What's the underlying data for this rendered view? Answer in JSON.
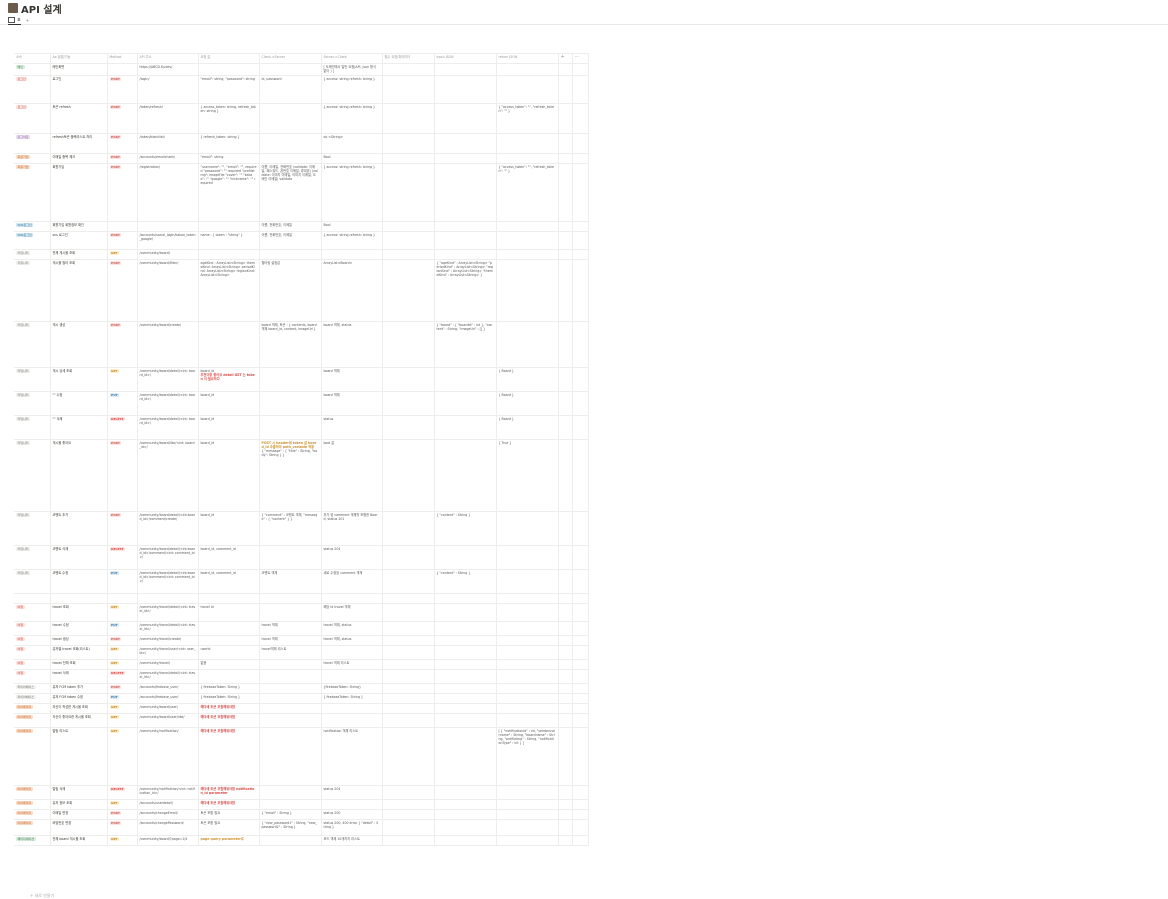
{
  "page": {
    "title": "API 설계",
    "icon_name": "page-icon"
  },
  "view": {
    "tab_label": "표",
    "add_label": "+"
  },
  "columns": [
    "소속",
    "Aa 설명/기능",
    "Method",
    "API 주소",
    "요청 값",
    "Client->Server",
    "Server->Client",
    "필수 요청/파라미터",
    "input JSON",
    "return JSON"
  ],
  "header_actions": {
    "add": "+",
    "more": "⋯"
  },
  "colors": {
    "GET": {
      "bg": "#fbeecf",
      "fg": "#b8862b"
    },
    "POST": {
      "bg": "#fde2e1",
      "fg": "#c4554d"
    },
    "PUT": {
      "bg": "#ddebf1",
      "fg": "#3b73a8"
    },
    "DELETE": {
      "bg": "#fde2e1",
      "fg": "#d44c47"
    }
  },
  "rows": [
    {
      "tag": "메인",
      "tag_bg": "#dbeddb",
      "tag_fg": "#448361",
      "name": "메인화면",
      "method": "",
      "url": "https://ABCD.fly.dev/",
      "req": "",
      "c2s": "",
      "s2c": "[ 도메인에서 일반 요청(API, json 형식 없이 ) ]",
      "input": "",
      "ret": "",
      "h": 12
    },
    {
      "tag": "로그인",
      "tag_bg": "#fde2e1",
      "tag_fg": "#c4554d",
      "name": "로그인",
      "method": "POST",
      "url": "/login/",
      "req": "\"email\": string, \"password\": string",
      "c2s": "id, password",
      "s2c": "{ access: string refresh: string }",
      "input": "",
      "ret": "",
      "h": 28
    },
    {
      "tag": "로그인",
      "tag_bg": "#fde2e1",
      "tag_fg": "#c4554d",
      "name": "토큰 refresh",
      "method": "POST",
      "url": "/token/refresh/",
      "req": "{ access_token: string, refresh_token: string }",
      "c2s": "",
      "s2c": "{ access: string refresh: string }",
      "input": "",
      "ret": "{ \"access_token\": \"\", \"refresh_token\": \"\" }",
      "h": 30
    },
    {
      "tag": "로그아웃",
      "tag_bg": "#e8deee",
      "tag_fg": "#9065b0",
      "name": "refresh토큰 블랙리스트 처리",
      "method": "POST",
      "url": "/token/blacklist/",
      "req": "{ refresh_token: string }",
      "c2s": "",
      "s2c": "ok <String>",
      "input": "",
      "ret": "",
      "h": 20
    },
    {
      "tag": "회원가입",
      "tag_bg": "#fadec9",
      "tag_fg": "#c2692c",
      "name": "이메일 중복 체크",
      "method": "POST",
      "url": "/accounts/emailcheck/",
      "req": "\"email\": string",
      "c2s": "",
      "s2c": "Bool",
      "input": "",
      "ret": "",
      "h": 10
    },
    {
      "tag": "회원가입",
      "tag_bg": "#fadec9",
      "tag_fg": "#c2692c",
      "name": "회원가입",
      "method": "POST",
      "url": "/registration/",
      "req": "\"username\": \"\", \"email\": \"\", required \"password\": \"\" required \"profileImg\": imageFile \"cover\": \"\" \"kakao\": \"\" \"google\": \"\" \"nickname\": \"\" required",
      "c2s": "이름, 이메일, 전화번호 (validate: 이메일, 패스워드, 폰번호 이메일, 휴대폰) (validate: 이미지 이메일, 이미지 이메일, 도메인 이메일) validate",
      "s2c": "{ access: string refresh: string }",
      "input": "",
      "ret": "{ \"access_token\": \"\", \"refresh_token\": \"\" }",
      "h": 58
    },
    {
      "tag": "SNS로그인",
      "tag_bg": "#d3e5ef",
      "tag_fg": "#337ea9",
      "name": "회원가입 회원정보 확인",
      "method": "",
      "url": "",
      "req": "",
      "c2s": "이름, 전화번호, 이메일",
      "s2c": "Bool",
      "input": "",
      "ret": "",
      "h": 10
    },
    {
      "tag": "SNS로그인",
      "tag_bg": "#d3e5ef",
      "tag_fg": "#337ea9",
      "name": "sns 로그인",
      "method": "POST",
      "url": "/accounts/social_login/kakao_token_google/",
      "req": "name : { token : \"string\" }",
      "c2s": "이름, 전화번호, 이메일",
      "s2c": "{ access: string refresh: string }",
      "input": "",
      "ret": "",
      "h": 18
    },
    {
      "tag": "커뮤니티",
      "tag_bg": "#f1f1ef",
      "tag_fg": "#787774",
      "name": "전체 게시물 조회",
      "method": "GET",
      "url": "/community/board/",
      "req": "",
      "c2s": "",
      "s2c": "",
      "input": "",
      "ret": "",
      "h": 10
    },
    {
      "tag": "커뮤니티",
      "tag_bg": "#f1f1ef",
      "tag_fg": "#787774",
      "name": "게시물 필터 조회",
      "method": "POST",
      "url": "/community/board/filter/",
      "req": "ageKind : ArrayList<String> themeKind: ArrayList<String> periodKind: ArrayList<String> regionKind: ArrayList<String>",
      "c2s": "필터링 설정값",
      "s2c": "ArrayList<Board>",
      "input": "{ \"ageKind\" : ArrayList<String> \"periodKind\" : ArrayList<String> \"regionKind\" : ArrayList<String> \"themeKind\" : ArrayList<String> }",
      "ret": "",
      "h": 62
    },
    {
      "tag": "커뮤니티",
      "tag_bg": "#f1f1ef",
      "tag_fg": "#787774",
      "name": "게시 생성",
      "method": "POST",
      "url": "/community/board/create/",
      "req": "",
      "c2s": "board 객체, 토큰 : { contents, board 객체 board_id, content, imageUrl }",
      "s2c": "board 객체, status",
      "input": "{ \"board\" : { \"boardId\" : int }, \"content\" : String, \"imageUrl\" : [] }",
      "ret": "",
      "h": 46
    },
    {
      "tag": "커뮤니티",
      "tag_bg": "#f1f1ef",
      "tag_fg": "#787774",
      "name": "게시 상세 조회",
      "method": "GET",
      "url": "/community/board/detail/<int: board_id>/",
      "req": "board_id",
      "req_red": "추천이랑 좋아요 detail GET 는 token 이 필요하다",
      "c2s": "",
      "s2c": "board 객체",
      "input": "",
      "ret": "{ Board }",
      "h": 24
    },
    {
      "tag": "커뮤니티",
      "tag_bg": "#f1f1ef",
      "tag_fg": "#787774",
      "name": "\"\" 수정",
      "method": "PUT",
      "url": "/community/board/detail/<int: board_id>/",
      "req": "board_id",
      "c2s": "",
      "s2c": "board 객체",
      "input": "",
      "ret": "{ Board }",
      "h": 24
    },
    {
      "tag": "커뮤니티",
      "tag_bg": "#f1f1ef",
      "tag_fg": "#787774",
      "name": "\"\" 삭제",
      "method": "DELETE",
      "url": "/community/board/detail/<int: board_id>/",
      "req": "board_id",
      "c2s": "",
      "s2c": "status",
      "input": "",
      "ret": "{ Board }",
      "h": 24
    },
    {
      "tag": "커뮤니티",
      "tag_bg": "#f1f1ef",
      "tag_fg": "#787774",
      "name": "게시물 좋아요",
      "method": "POST",
      "url": "/community/board/like/<int: board_id>/",
      "req": "board_id",
      "c2s_org": "POST 시 header에 token 값 board_id 추출하여 path_variable 적용",
      "c2s": "{ \"message\" : { \"title\" : String, \"body\": String } }",
      "s2c": "bool 값",
      "input": "",
      "ret": "{ True }",
      "h": 72
    },
    {
      "tag": "커뮤니티",
      "tag_bg": "#f1f1ef",
      "tag_fg": "#787774",
      "name": "코멘트 추가",
      "method": "POST",
      "url": "/community/board/detail/<int:board_id>/comment/create/",
      "req": "board_id",
      "c2s": "{ \"comment\" : 코멘트 객체, \"message\" : { \"content\" } }",
      "s2c": "추가 된 comment 객체를 포함한 Board, status 201",
      "input": "{ \"content\" : String }",
      "ret": "",
      "h": 34
    },
    {
      "tag": "커뮤니티",
      "tag_bg": "#f1f1ef",
      "tag_fg": "#787774",
      "name": "코멘트 삭제",
      "method": "DELETE",
      "url": "/community/board/detail/<int:board_id>/comment/<int: comment_id>/",
      "req": "board_id, comment_id",
      "c2s": "",
      "s2c": "status 204",
      "input": "",
      "ret": "",
      "h": 24
    },
    {
      "tag": "커뮤니티",
      "tag_bg": "#f1f1ef",
      "tag_fg": "#787774",
      "name": "코멘트 수정",
      "method": "PUT",
      "url": "/community/board/detail/<int:board_id>/comment/<int: comment_id>/",
      "req": "board_id, comment_id",
      "c2s": "코멘트 객체",
      "s2c": "새로 수정된 comment 객체",
      "input": "{ \"content\" : String }",
      "ret": "",
      "h": 24
    },
    {
      "tag": "",
      "tag_bg": "",
      "tag_fg": "",
      "name": "",
      "method": "",
      "url": "",
      "req": "",
      "c2s": "",
      "s2c": "",
      "input": "",
      "ret": "",
      "h": 10
    },
    {
      "tag": "여행",
      "tag_bg": "#fde2e1",
      "tag_fg": "#c4554d",
      "name": "travel 조회",
      "method": "GET",
      "url": "/community/travel/detail/<int: travel_id>/",
      "req": "travel id",
      "c2s": "",
      "s2c": "해당 id travel 객체",
      "input": "",
      "ret": "",
      "h": 18
    },
    {
      "tag": "여행",
      "tag_bg": "#fde2e1",
      "tag_fg": "#c4554d",
      "name": "travel 수정",
      "method": "PUT",
      "url": "/community/travel/detail/<int: travel_id>/",
      "req": "",
      "c2s": "travel 객체",
      "s2c": "travel 객체, status",
      "input": "",
      "ret": "",
      "h": 14
    },
    {
      "tag": "여행",
      "tag_bg": "#fde2e1",
      "tag_fg": "#c4554d",
      "name": "travel 생성",
      "method": "POST",
      "url": "/community/travel/create/",
      "req": "",
      "c2s": "travel 객체",
      "s2c": "travel 객체, status",
      "input": "",
      "ret": "",
      "h": 10
    },
    {
      "tag": "여행",
      "tag_bg": "#fde2e1",
      "tag_fg": "#c4554d",
      "name": "유저별 travel 조회(리스트)",
      "method": "GET",
      "url": "/community/travel/user/<int: user_id>/",
      "req": "userId",
      "c2s": "travel객체 리스트",
      "s2c": "",
      "input": "",
      "ret": "",
      "h": 14
    },
    {
      "tag": "여행",
      "tag_bg": "#fde2e1",
      "tag_fg": "#c4554d",
      "name": "travel 전체 조회",
      "method": "GET",
      "url": "/community/travel/",
      "req": "없음",
      "c2s": "",
      "s2c": "travel 객체 리스트",
      "input": "",
      "ret": "",
      "h": 10
    },
    {
      "tag": "여행",
      "tag_bg": "#fde2e1",
      "tag_fg": "#c4554d",
      "name": "travel 삭제",
      "method": "DELETE",
      "url": "/community/travel/detail/<int: travel_id>/",
      "req": "",
      "c2s": "",
      "s2c": "",
      "input": "",
      "ret": "",
      "h": 14
    },
    {
      "tag": "파이어베이스",
      "tag_bg": "#f1f1ef",
      "tag_fg": "#787774",
      "name": "유저 FCM token 추가",
      "method": "POST",
      "url": "/accounts/firebase_user/",
      "req": "{ firebaseToken: String }",
      "c2s": "",
      "s2c": "{firebaseToken: String}",
      "input": "",
      "ret": "",
      "h": 10
    },
    {
      "tag": "파이어베이스",
      "tag_bg": "#f1f1ef",
      "tag_fg": "#787774",
      "name": "유저 FCM token 수정",
      "method": "PUT",
      "url": "/accounts/firebase_user/",
      "req": "{ firebaseToken: String }",
      "c2s": "",
      "s2c": "{ firebaseToken: String }",
      "input": "",
      "ret": "",
      "h": 10
    },
    {
      "tag": "마이페이지",
      "tag_bg": "#fadec9",
      "tag_fg": "#c2692c",
      "name": "자신이 작성한 게시물 조회",
      "method": "GET",
      "url": "/community/board/user/",
      "req_red": "헤더에 토큰 포함해줘야함",
      "req": "",
      "c2s": "",
      "s2c": "",
      "input": "",
      "ret": "",
      "h": 10
    },
    {
      "tag": "마이페이지",
      "tag_bg": "#fadec9",
      "tag_fg": "#c2692c",
      "name": "자신이 좋아요한 게시물 조회",
      "method": "GET",
      "url": "/community/board/user/like/",
      "req_red": "헤더에 토큰 포함해줘야함",
      "req": "",
      "c2s": "",
      "s2c": "",
      "input": "",
      "ret": "",
      "h": 14
    },
    {
      "tag": "마이페이지",
      "tag_bg": "#fadec9",
      "tag_fg": "#c2692c",
      "name": "알림 리스트",
      "method": "GET",
      "url": "/community/notification/",
      "req_red": "헤더에 토큰 포함해줘야함",
      "req": "",
      "c2s": "",
      "s2c": "notification 객체 리스트",
      "input": "",
      "ret": "[ { \"notificationId\" : int, \"senderusername\" : String, \"boardname\" : String, \"profileImg\" : String, \"notificationType\" : int } ]",
      "h": 58
    },
    {
      "tag": "마이페이지",
      "tag_bg": "#fadec9",
      "tag_fg": "#c2692c",
      "name": "알림 삭제",
      "method": "DELETE",
      "url": "/community/notification/<int: notification_id>/",
      "req_red": "헤더에 토큰 포함해줘야함 notification_id parameter",
      "req": "",
      "c2s": "",
      "s2c": "status 204",
      "input": "",
      "ret": "",
      "h": 14
    },
    {
      "tag": "마이페이지",
      "tag_bg": "#fadec9",
      "tag_fg": "#c2692c",
      "name": "유저 정보 조회",
      "method": "GET",
      "url": "/accounts/userdetail/",
      "req_red": "헤더에 토큰 포함해줘야함",
      "req": "",
      "c2s": "",
      "s2c": "",
      "input": "",
      "ret": "",
      "h": 10
    },
    {
      "tag": "마이페이지",
      "tag_bg": "#fadec9",
      "tag_fg": "#c2692c",
      "name": "이메일 변경",
      "method": "POST",
      "url": "/accounts/changeEmail/",
      "req": "토큰 포함 필요",
      "c2s": "{ \"email\" : String }",
      "s2c": "status 200",
      "input": "",
      "ret": "",
      "h": 10
    },
    {
      "tag": "마이페이지",
      "tag_bg": "#fadec9",
      "tag_fg": "#c2692c",
      "name": "비밀번호 변경",
      "method": "POST",
      "url": "/accounts/changePassword/",
      "req": "토큰 포함 필요",
      "c2s": "{ \"new_password1\" : String, \"new_password2\" : String }",
      "s2c": "status 200, 400 error { \"detail\" : String }",
      "input": "",
      "ret": "",
      "h": 16
    },
    {
      "tag": "페이지네이션",
      "tag_bg": "#dbeddb",
      "tag_fg": "#448361",
      "name": "전체 board 게시물 조회",
      "method": "GET",
      "url": "/community/board/?page=1/4",
      "req_org": "page query parameter로",
      "req": "",
      "c2s": "",
      "s2c": "보드 객체 10개까지 리스트",
      "input": "",
      "ret": "",
      "h": 10
    }
  ],
  "footer": {
    "new_label": "+ 새로 만들기"
  }
}
